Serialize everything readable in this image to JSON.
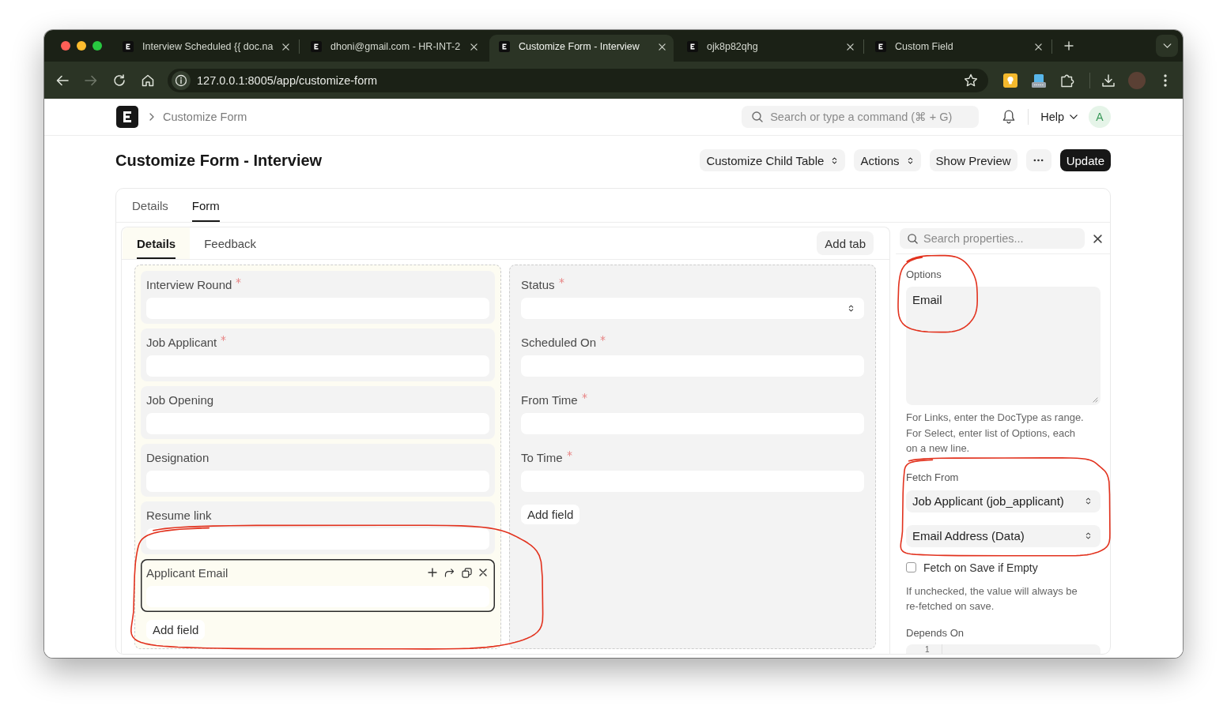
{
  "browser": {
    "tabs": [
      {
        "title": "Interview Scheduled {{ doc.na",
        "selected": false
      },
      {
        "title": "dhoni@gmail.com - HR-INT-2",
        "selected": false
      },
      {
        "title": "Customize Form - Interview",
        "selected": true
      },
      {
        "title": "ojk8p82qhg",
        "selected": false
      },
      {
        "title": "Custom Field",
        "selected": false
      }
    ],
    "forward_disabled": true,
    "address": "127.0.0.1:8005/app/customize-form"
  },
  "navbar": {
    "breadcrumb": "Customize Form",
    "search": {
      "placeholder": "Search or type a command (⌘ + G)"
    },
    "help": "Help",
    "avatar": "A"
  },
  "page": {
    "title": "Customize Form - Interview",
    "actions": [
      {
        "kind": "dropdown",
        "label": "Customize Child Table"
      },
      {
        "kind": "dropdown",
        "label": "Actions"
      },
      {
        "kind": "plain",
        "label": "Show Preview"
      },
      {
        "kind": "more"
      },
      {
        "kind": "primary",
        "label": "Update"
      }
    ]
  },
  "main_tabs": [
    {
      "label": "Details",
      "selected": false
    },
    {
      "label": "Form",
      "selected": true
    }
  ],
  "form_tabs": [
    {
      "label": "Details",
      "selected": true
    },
    {
      "label": "Feedback",
      "selected": false
    }
  ],
  "add_tab": "Add tab",
  "columns": [
    {
      "add_field": "Add field",
      "fields": [
        {
          "label": "Interview Round",
          "kind": "data",
          "required": true,
          "selected": false,
          "circled": false
        },
        {
          "label": "Job Applicant",
          "kind": "data",
          "required": true,
          "selected": false,
          "circled": false
        },
        {
          "label": "Job Opening",
          "kind": "data",
          "required": false,
          "selected": false,
          "circled": false
        },
        {
          "label": "Designation",
          "kind": "data",
          "required": false,
          "selected": false,
          "circled": false
        },
        {
          "label": "Resume link",
          "kind": "data",
          "required": false,
          "selected": false,
          "circled": false
        },
        {
          "label": "Applicant Email",
          "kind": "data",
          "required": false,
          "selected": true,
          "circled": true
        }
      ]
    },
    {
      "add_field": "Add field",
      "fields": [
        {
          "label": "Status",
          "kind": "select",
          "required": true,
          "selected": false,
          "circled": false
        },
        {
          "label": "Scheduled On",
          "kind": "data",
          "required": true,
          "selected": false,
          "circled": false
        },
        {
          "label": "From Time",
          "kind": "data",
          "required": true,
          "selected": false,
          "circled": false
        },
        {
          "label": "To Time",
          "kind": "data",
          "required": true,
          "selected": false,
          "circled": false
        }
      ]
    }
  ],
  "properties": {
    "search": {
      "placeholder": "Search properties..."
    },
    "options": {
      "label": "Options",
      "value": "Email",
      "circled": true
    },
    "options_help": "For Links, enter the DocType as range.\nFor Select, enter list of Options, each on a new line.",
    "fetch_from": {
      "label": "Fetch From",
      "selects": [
        "Job Applicant (job_applicant)",
        "Email Address (Data)"
      ],
      "circled": true
    },
    "fetch_on_save": {
      "label": "Fetch on Save if Empty",
      "checked": false
    },
    "fetch_help": "If unchecked, the value will always be re-fetched on save.",
    "depends_on": {
      "label": "Depends On",
      "line_number": "1"
    }
  }
}
